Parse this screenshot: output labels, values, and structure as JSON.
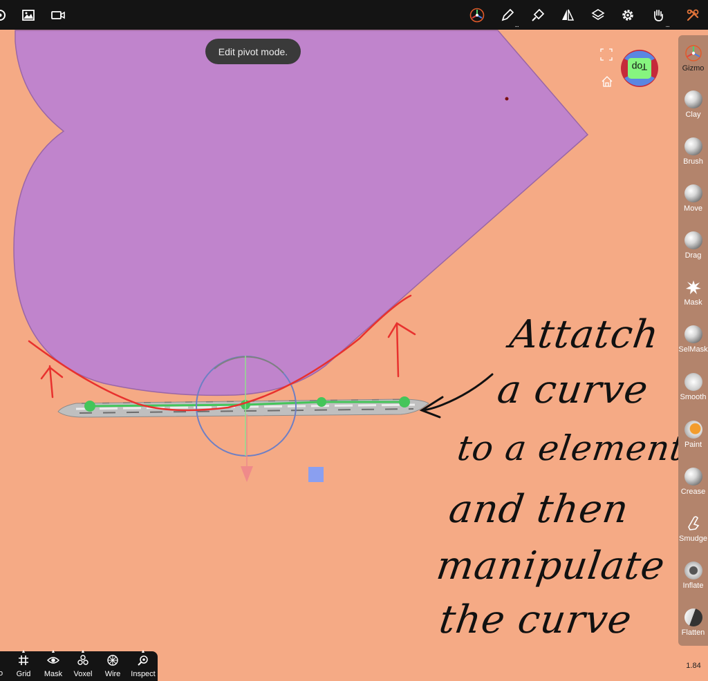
{
  "toast": {
    "text": "Edit pivot mode."
  },
  "sidebar": {
    "tools": [
      {
        "id": "gizmo",
        "label": "Gizmo",
        "active": true
      },
      {
        "id": "clay",
        "label": "Clay"
      },
      {
        "id": "brush",
        "label": "Brush"
      },
      {
        "id": "move",
        "label": "Move"
      },
      {
        "id": "drag",
        "label": "Drag"
      },
      {
        "id": "mask",
        "label": "Mask"
      },
      {
        "id": "selmask",
        "label": "SelMask"
      },
      {
        "id": "smooth",
        "label": "Smooth"
      },
      {
        "id": "paint",
        "label": "Paint"
      },
      {
        "id": "crease",
        "label": "Crease"
      },
      {
        "id": "smudge",
        "label": "Smudge"
      },
      {
        "id": "inflate",
        "label": "Inflate"
      },
      {
        "id": "flatten",
        "label": "Flatten"
      }
    ]
  },
  "viewcube": {
    "face_label": "Top"
  },
  "bottom_bar": {
    "items": [
      {
        "id": "grid",
        "label": "Grid",
        "icon": "grid-icon"
      },
      {
        "id": "mask",
        "label": "Mask",
        "icon": "eye-icon"
      },
      {
        "id": "voxel",
        "label": "Voxel",
        "icon": "voxel-icon"
      },
      {
        "id": "wire",
        "label": "Wire",
        "icon": "wireframe-icon"
      },
      {
        "id": "inspect",
        "label": "Inspect",
        "icon": "inspect-icon"
      }
    ],
    "cut_label": "o"
  },
  "zoom": {
    "value": "1.84"
  },
  "annotation": {
    "lines": [
      "Attatch",
      "a curve",
      "to a element",
      "and then",
      "manipulate",
      "the curve"
    ]
  },
  "colors": {
    "background": "#f5aa85",
    "mesh": "#c084cc",
    "curve": "#44c55a",
    "ink_red": "#e8312e",
    "ink_black": "#111111"
  }
}
